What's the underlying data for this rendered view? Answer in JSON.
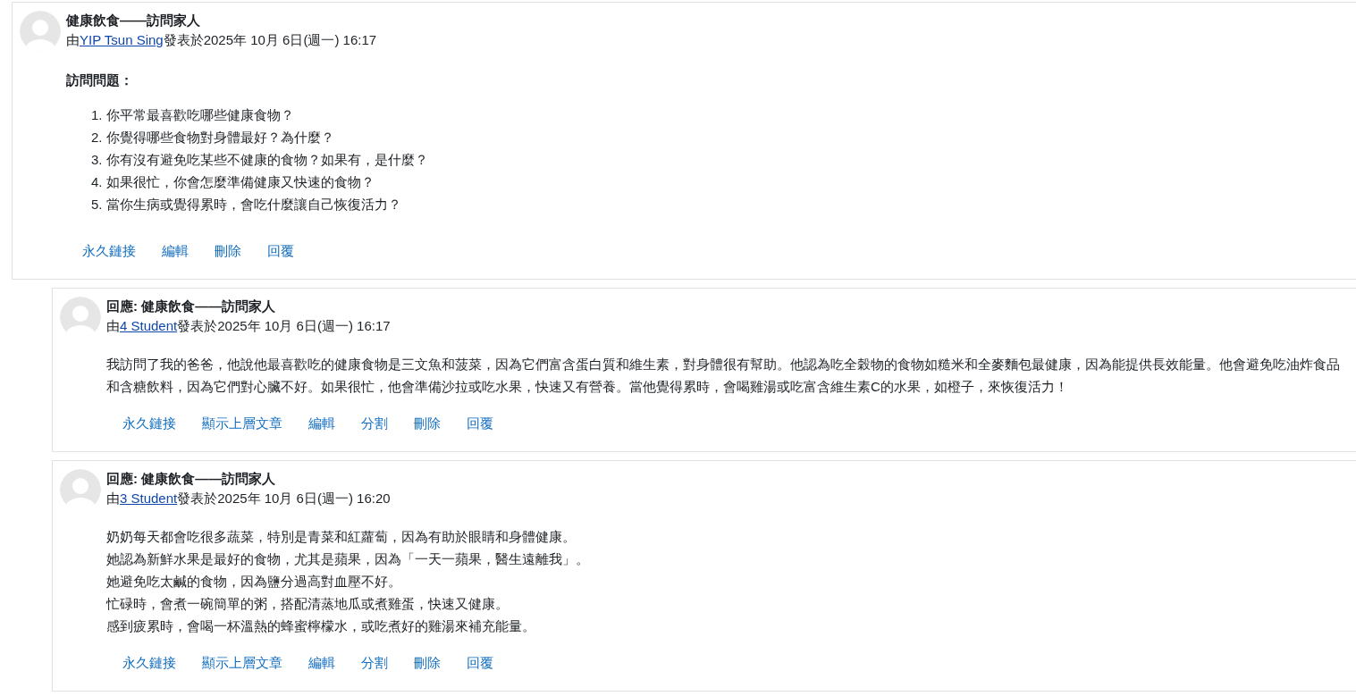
{
  "posts": [
    {
      "reply": false,
      "title": "健康飲食——訪問家人",
      "byline": {
        "prefix": "由",
        "author": "YIP Tsun Sing",
        "suffix": "發表於2025年 10月 6日(週一) 16:17"
      },
      "body": [
        {
          "kind": "heading",
          "text": "訪問問題："
        },
        {
          "kind": "ordered_list",
          "items": [
            {
              "number": "1.",
              "text": "你平常最喜歡吃哪些健康食物？"
            },
            {
              "number": "2.",
              "text": "你覺得哪些食物對身體最好？為什麼？"
            },
            {
              "number": "3.",
              "text": "你有沒有避免吃某些不健康的食物？如果有，是什麼？"
            },
            {
              "number": "4.",
              "text": "如果很忙，你會怎麼準備健康又快速的食物？"
            },
            {
              "number": "5.",
              "text": "當你生病或覺得累時，會吃什麼讓自己恢復活力？"
            }
          ]
        }
      ],
      "actions": [
        "永久鏈接",
        "編輯",
        "刪除",
        "回覆"
      ]
    },
    {
      "reply": true,
      "title": "回應: 健康飲食——訪問家人",
      "byline": {
        "prefix": "由",
        "author": "4 Student",
        "suffix": "發表於2025年 10月 6日(週一) 16:17"
      },
      "body": [
        {
          "kind": "paragraph",
          "text": "我訪問了我的爸爸，他說他最喜歡吃的健康食物是三文魚和菠菜，因為它們富含蛋白質和維生素，對身體很有幫助。他認為吃全穀物的食物如糙米和全麥麵包最健康，因為能提供長效能量。他會避免吃油炸食品和含糖飲料，因為它們對心臟不好。如果很忙，他會準備沙拉或吃水果，快速又有營養。當他覺得累時，會喝雞湯或吃富含維生素C的水果，如橙子，來恢復活力！"
        }
      ],
      "actions": [
        "永久鏈接",
        "顯示上層文章",
        "編輯",
        "分割",
        "刪除",
        "回覆"
      ]
    },
    {
      "reply": true,
      "title": "回應: 健康飲食——訪問家人",
      "byline": {
        "prefix": "由",
        "author": "3 Student",
        "suffix": "發表於2025年 10月 6日(週一) 16:20"
      },
      "body": [
        {
          "kind": "lines",
          "items": [
            "奶奶每天都會吃很多蔬菜，特別是青菜和紅蘿蔔，因為有助於眼睛和身體健康。",
            "她認為新鮮水果是最好的食物，尤其是蘋果，因為「一天一蘋果，醫生遠離我」。",
            "她避免吃太鹹的食物，因為鹽分過高對血壓不好。",
            "忙碌時，會煮一碗簡單的粥，搭配清蒸地瓜或煮雞蛋，快速又健康。",
            "感到疲累時，會喝一杯溫熱的蜂蜜檸檬水，或吃煮好的雞湯來補充能量。"
          ]
        }
      ],
      "actions": [
        "永久鏈接",
        "顯示上層文章",
        "編輯",
        "分割",
        "刪除",
        "回覆"
      ]
    }
  ]
}
